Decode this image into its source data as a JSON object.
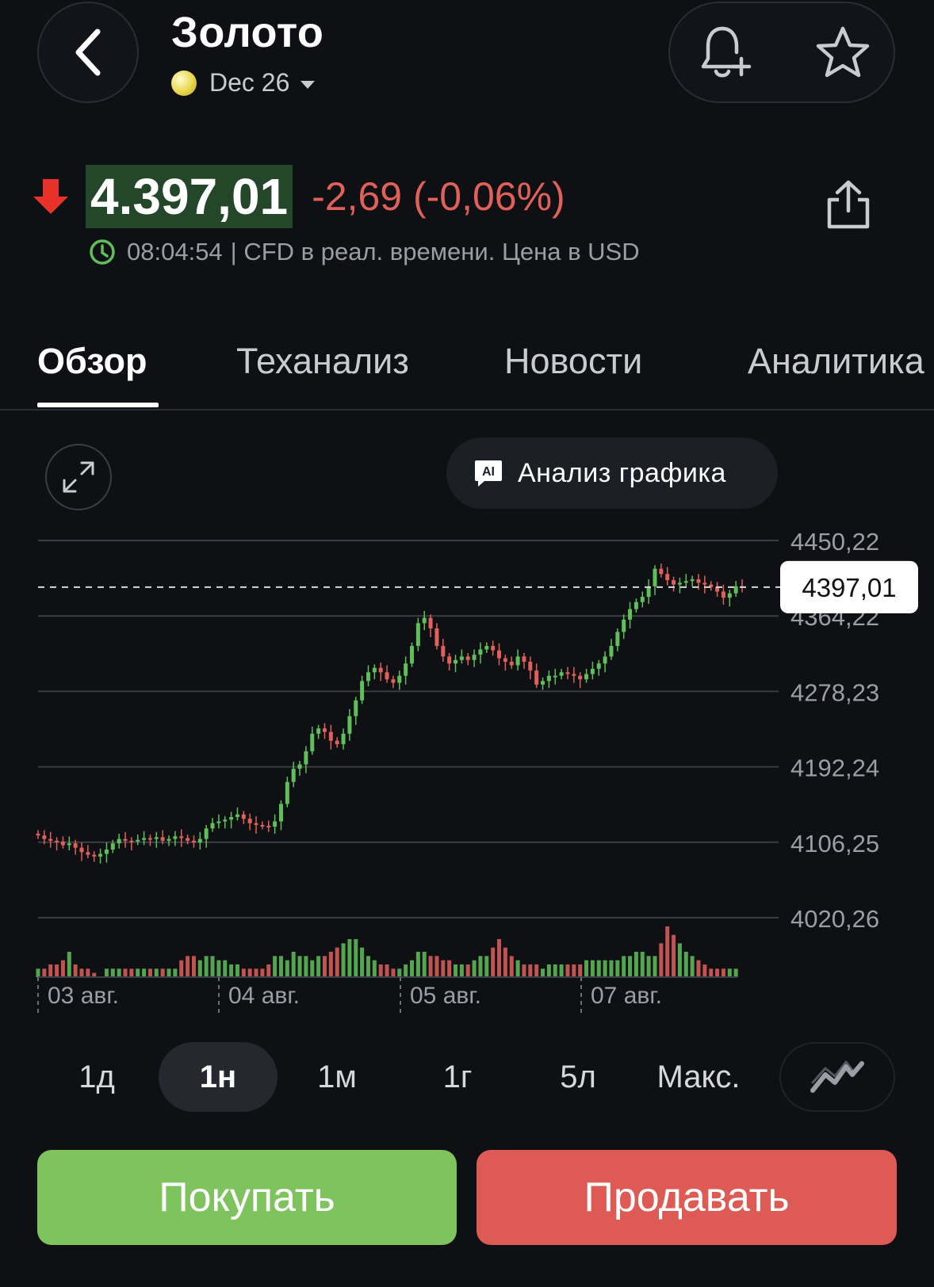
{
  "header": {
    "title": "Золото",
    "contract": "Dec 26",
    "back_icon": "chevron-left-icon",
    "alert_icon": "bell-plus-icon",
    "favorite_icon": "star-icon"
  },
  "quote": {
    "price": "4.397,01",
    "change": "-2,69 (-0,06%)",
    "direction_icon": "arrow-down-icon",
    "time": "08:04:54",
    "description": "| CFD в реал. времени. Цена в USD",
    "colors": {
      "price_bg": "#24472a",
      "down": "#e0605a",
      "clock": "#5fbf5a"
    }
  },
  "tabs": [
    {
      "label": "Обзор",
      "active": true
    },
    {
      "label": "Теханализ",
      "active": false
    },
    {
      "label": "Новости",
      "active": false
    },
    {
      "label": "Аналитика",
      "active": false
    }
  ],
  "toolbar": {
    "expand_icon": "expand-icon",
    "ai_badge": "AI",
    "ai_button_label": "Анализ графика"
  },
  "chart_data": {
    "type": "candlestick",
    "y_ticks": [
      "4450,22",
      "4364,22",
      "4278,23",
      "4192,24",
      "4106,25",
      "4020,26"
    ],
    "ylim": [
      4020.26,
      4450.22
    ],
    "x_ticks": [
      "03 авг.",
      "04 авг.",
      "05 авг.",
      "07 авг."
    ],
    "current_price_label": "4397,01",
    "current_price": 4397.01,
    "grid": true,
    "colors": {
      "up": "#5fbf5a",
      "down": "#e0605a",
      "grid": "#3a3d44"
    },
    "candles": [
      4114,
      4110,
      4108,
      4107,
      4103,
      4105,
      4100,
      4095,
      4092,
      4090,
      4093,
      4098,
      4105,
      4110,
      4108,
      4107,
      4109,
      4111,
      4110,
      4112,
      4108,
      4110,
      4113,
      4111,
      4108,
      4106,
      4110,
      4122,
      4128,
      4130,
      4132,
      4135,
      4138,
      4133,
      4128,
      4126,
      4125,
      4124,
      4130,
      4150,
      4175,
      4190,
      4195,
      4210,
      4230,
      4236,
      4232,
      4222,
      4218,
      4230,
      4250,
      4268,
      4290,
      4300,
      4305,
      4300,
      4292,
      4288,
      4296,
      4310,
      4330,
      4356,
      4362,
      4350,
      4330,
      4318,
      4310,
      4314,
      4318,
      4314,
      4320,
      4326,
      4330,
      4325,
      4316,
      4312,
      4308,
      4318,
      4312,
      4302,
      4286,
      4290,
      4296,
      4296,
      4300,
      4298,
      4296,
      4292,
      4298,
      4304,
      4310,
      4318,
      4330,
      4346,
      4360,
      4372,
      4380,
      4386,
      4398,
      4418,
      4412,
      4405,
      4400,
      4402,
      4404,
      4406,
      4402,
      4400,
      4397,
      4392,
      4385,
      4390,
      4398,
      4397.01
    ],
    "volume": [
      2,
      2,
      3,
      3,
      4,
      6,
      3,
      2,
      2,
      1,
      0,
      2,
      2,
      2,
      2,
      2,
      2,
      2,
      2,
      2,
      2,
      2,
      2,
      4,
      5,
      5,
      4,
      5,
      5,
      4,
      4,
      3,
      3,
      2,
      2,
      2,
      2,
      3,
      5,
      5,
      4,
      6,
      5,
      5,
      4,
      5,
      5,
      6,
      7,
      8,
      9,
      9,
      7,
      5,
      4,
      3,
      3,
      2,
      2,
      3,
      4,
      6,
      6,
      5,
      5,
      4,
      4,
      3,
      3,
      3,
      4,
      5,
      5,
      7,
      9,
      7,
      5,
      4,
      3,
      3,
      3,
      2,
      3,
      3,
      3,
      3,
      3,
      3,
      4,
      4,
      4,
      4,
      4,
      4,
      5,
      5,
      6,
      6,
      5,
      5,
      8,
      12,
      10,
      8,
      6,
      5,
      4,
      3,
      2,
      2,
      2,
      2,
      2
    ]
  },
  "ranges": [
    {
      "label": "1д",
      "active": false
    },
    {
      "label": "1н",
      "active": true
    },
    {
      "label": "1м",
      "active": false
    },
    {
      "label": "1г",
      "active": false
    },
    {
      "label": "5л",
      "active": false
    },
    {
      "label": "Макс.",
      "active": false
    }
  ],
  "chart_type_icon": "line-chart-icon",
  "actions": {
    "buy_label": "Покупать",
    "sell_label": "Продавать",
    "buy_color": "#7ec35e",
    "sell_color": "#de5a54"
  }
}
